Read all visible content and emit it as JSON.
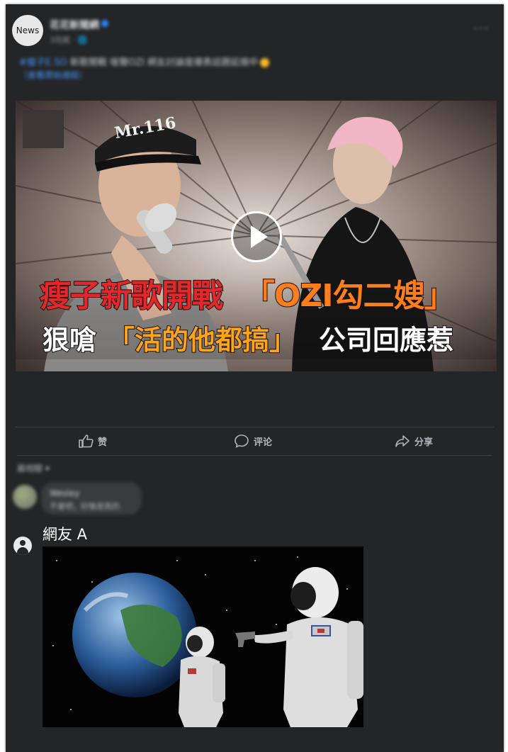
{
  "post": {
    "avatar_text": "News",
    "page_name": "花花新聞網",
    "time": "3月前 · 🌐",
    "more": "···",
    "caption_tag": "#瘦子E.SO",
    "caption_text": "新歌開戰 嗆聲OZI 網友討論度爆表話題延燒中",
    "caption_more": "（查看原始連結）"
  },
  "video": {
    "headline_red": "瘦子新歌開戰",
    "headline_orange": "「OZI勾二嫂」",
    "sub_a": "狠嗆",
    "sub_b": "「活的他都搞」",
    "sub_c": "公司回應惹",
    "cap_text": "Mr.116"
  },
  "actions": {
    "like": "赞",
    "comment": "评论",
    "share": "分享"
  },
  "comments": {
    "sort_label": "最相關 ▾",
    "first": {
      "name": "Wesley",
      "text": "不會吧，好像是真的"
    },
    "second": {
      "name": "網友 A"
    }
  }
}
